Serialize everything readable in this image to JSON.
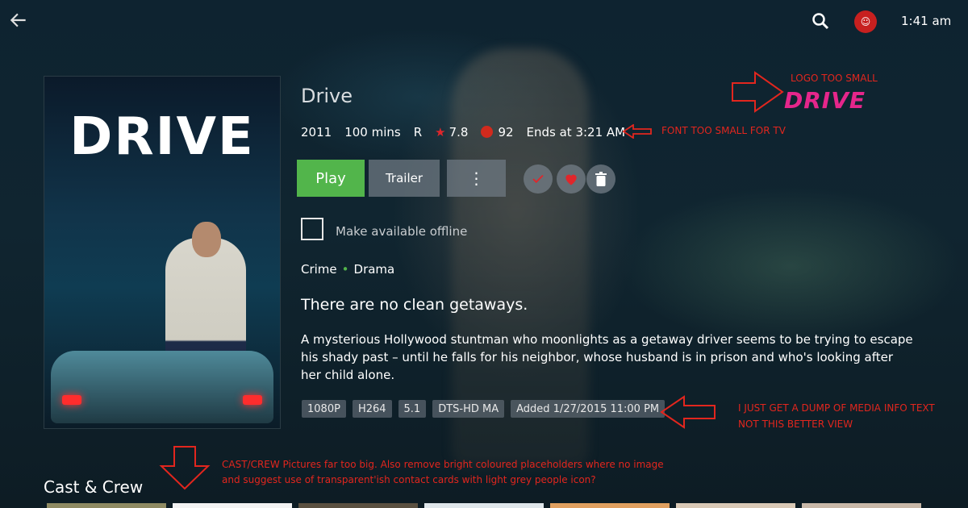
{
  "header": {
    "time": "1:41 am",
    "avatar_text": "☺"
  },
  "poster": {
    "title": "DRIVE"
  },
  "movie": {
    "title": "Drive",
    "year": "2011",
    "runtime": "100 mins",
    "rating": "R",
    "community_rating": "7.8",
    "critic_rating": "92",
    "ends_at": "Ends at 3:21 AM"
  },
  "actions": {
    "play": "Play",
    "trailer": "Trailer",
    "more": "⋮"
  },
  "offline_label": "Make available offline",
  "genres": [
    "Crime",
    "Drama"
  ],
  "tagline": "There are no clean getaways.",
  "overview": "A mysterious Hollywood stuntman who moonlights as a getaway driver seems to be trying to escape his shady past – until he falls for his neighbor, whose husband is in prison and who's looking after her child alone.",
  "media_info": [
    "1080P",
    "H264",
    "5.1",
    "DTS-HD MA",
    "Added 1/27/2015 11:00 PM"
  ],
  "cast_section_title": "Cast & Crew",
  "annotations": {
    "logo": "LOGO TOO SMALL",
    "logo_word": "DRIVE",
    "font": "FONT TOO SMALL FOR TV",
    "media_line1": "I JUST GET A DUMP OF MEDIA INFO TEXT",
    "media_line2": "NOT THIS BETTER VIEW",
    "cast_line1": "CAST/CREW Pictures far too big. Also remove bright coloured placeholders where no image",
    "cast_line2": "and suggest use of transparent'ish contact cards with light grey people icon?"
  },
  "colors": {
    "play": "#52b54b",
    "annotation": "#e2261e",
    "logo": "#e5268b",
    "star": "#e0262b"
  }
}
